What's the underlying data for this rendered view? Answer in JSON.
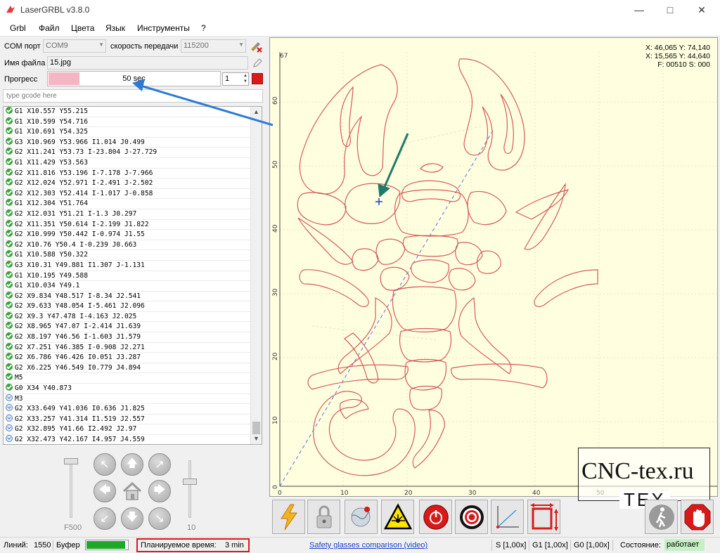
{
  "window": {
    "title": "LaserGRBL v3.8.0"
  },
  "menu": [
    "Grbl",
    "Файл",
    "Цвета",
    "Язык",
    "Инструменты",
    "?"
  ],
  "connection": {
    "port_label": "COM порт",
    "port_value": "COM9",
    "baud_label": "скорость передачи",
    "baud_value": "115200"
  },
  "file": {
    "label": "Имя файла",
    "value": "15.jpg"
  },
  "progress": {
    "label": "Прогресс",
    "text": "50 sec",
    "fraction": 0.18,
    "count": "1"
  },
  "gcode_input": {
    "placeholder": "type gcode here"
  },
  "gcode_lines": [
    {
      "status": "ok",
      "text": "G1 X10.557 Y55.215"
    },
    {
      "status": "ok",
      "text": "G1 X10.599 Y54.716"
    },
    {
      "status": "ok",
      "text": "G1 X10.691 Y54.325"
    },
    {
      "status": "ok",
      "text": "G3 X10.969 Y53.966 I1.014 J0.499"
    },
    {
      "status": "ok",
      "text": "G2 X11.241 Y53.73 I-23.804 J-27.729"
    },
    {
      "status": "ok",
      "text": "G1 X11.429 Y53.563"
    },
    {
      "status": "ok",
      "text": "G2 X11.816 Y53.196 I-7.178 J-7.966"
    },
    {
      "status": "ok",
      "text": "G2 X12.024 Y52.971 I-2.491 J-2.502"
    },
    {
      "status": "ok",
      "text": "G2 X12.303 Y52.414 I-1.017 J-0.858"
    },
    {
      "status": "ok",
      "text": "G1 X12.304 Y51.764"
    },
    {
      "status": "ok",
      "text": "G2 X12.031 Y51.21 I-1.3 J0.297"
    },
    {
      "status": "ok",
      "text": "G2 X11.351 Y50.614 I-2.199 J1.822"
    },
    {
      "status": "ok",
      "text": "G2 X10.999 Y50.442 I-0.974 J1.55"
    },
    {
      "status": "ok",
      "text": "G2 X10.76 Y50.4 I-0.239 J0.663"
    },
    {
      "status": "ok",
      "text": "G1 X10.588 Y50.322"
    },
    {
      "status": "ok",
      "text": "G3 X10.31 Y49.881 I1.307 J-1.131"
    },
    {
      "status": "ok",
      "text": "G1 X10.195 Y49.588"
    },
    {
      "status": "ok",
      "text": "G1 X10.034 Y49.1"
    },
    {
      "status": "ok",
      "text": "G2 X9.834 Y48.517 I-8.34 J2.541"
    },
    {
      "status": "ok",
      "text": "G2 X9.633 Y48.054 I-5.461 J2.096"
    },
    {
      "status": "ok",
      "text": "G2 X9.3 Y47.478 I-4.163 J2.025"
    },
    {
      "status": "ok",
      "text": "G2 X8.965 Y47.07 I-2.414 J1.639"
    },
    {
      "status": "ok",
      "text": "G2 X8.197 Y46.56 I-1.603 J1.579"
    },
    {
      "status": "ok",
      "text": "G2 X7.251 Y46.385 I-0.908 J2.271"
    },
    {
      "status": "ok",
      "text": "G2 X6.786 Y46.426 I0.051 J3.287"
    },
    {
      "status": "ok",
      "text": "G2 X6.225 Y46.549 I0.779 J4.894"
    },
    {
      "status": "ok",
      "text": "M5"
    },
    {
      "status": "ok",
      "text": "G0 X34 Y40.873"
    },
    {
      "status": "pending",
      "text": "M3"
    },
    {
      "status": "pending",
      "text": "G2 X33.649 Y41.036 I0.636 J1.825"
    },
    {
      "status": "pending",
      "text": "G2 X33.257 Y41.314 I1.519 J2.557"
    },
    {
      "status": "pending",
      "text": "G2 X32.895 Y41.66 I2.492 J2.97"
    },
    {
      "status": "pending",
      "text": "G2 X32.473 Y42.167 I4.957 J4.559"
    }
  ],
  "jog": {
    "feed_label": "F500",
    "step_label": "10"
  },
  "canvas": {
    "coords": [
      "X: 46,065 Y: 74,140",
      "X: 15,565 Y: 44,640",
      "F: 00510 S: 000"
    ],
    "y_ticks": [
      "0",
      "10",
      "20",
      "30",
      "40",
      "50",
      "60",
      "67"
    ],
    "x_ticks": [
      "0",
      "10",
      "20",
      "30",
      "40",
      "50",
      "60"
    ]
  },
  "watermark": {
    "main": "CNC-tex.ru",
    "sub": "TEX"
  },
  "status": {
    "lines_label": "Линий:",
    "lines_value": "1550",
    "buffer_label": "Буфер",
    "buffer_fraction": 0.95,
    "planned_label": "Планируемое время:",
    "planned_value": "3 min",
    "link": "Safety glasses comparison (video)",
    "s_override": "S [1,00x]",
    "g1_override": "G1 [1,00x]",
    "g0_override": "G0 [1,00x]",
    "state_label": "Состояние:",
    "state_value": "работает"
  },
  "colors": {
    "accent_red": "#d81a1a",
    "canvas_bg": "#ffffe0",
    "path_red": "#d45a5a",
    "arrow_blue": "#2b7bd6",
    "arrow_teal": "#1f7a6a",
    "buffer_green": "#1ea82a"
  }
}
